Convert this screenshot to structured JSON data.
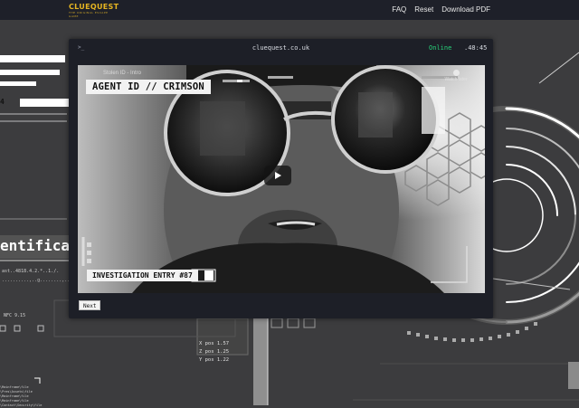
{
  "brand": {
    "name": "CLUEQUEST",
    "tagline": "THE ORIGINAL ESCAPE GAME"
  },
  "nav": {
    "faq": "FAQ",
    "reset": "Reset",
    "download": "Download PDF"
  },
  "background": {
    "left_number": "4",
    "heading": "entificat",
    "code1": "ast..4818.4.2.*..1./.",
    "code2": "..........,..g........,..2514",
    "nfc": "NFC 9.15",
    "list": [
      "\\Mainframe\\file",
      "\\Pres\\Assets\\file",
      "\\Mainframe\\file",
      "\\Mainframe\\file",
      "\\Contact\\Security\\file"
    ],
    "pos": [
      "X pos 1.57",
      "Z pos 1.25",
      "Y pos 1.22"
    ]
  },
  "modal": {
    "prompt": ">_",
    "domain": "cluequest.co.uk",
    "status": "Online",
    "clock": ".48:45"
  },
  "video": {
    "title": "Stolen ID - Intro",
    "watch_later": "Watch later",
    "overlay_top": "AGENT ID // CRIMSON",
    "overlay_bottom": "INVESTIGATION ENTRY #87"
  },
  "actions": {
    "next": "Next"
  },
  "colors": {
    "accent": "#e6b521",
    "online": "#27d27a",
    "modal": "#1d1f27",
    "topbar": "#1e2029"
  },
  "icons": {
    "play": "play-icon",
    "clock": "clock-icon"
  }
}
